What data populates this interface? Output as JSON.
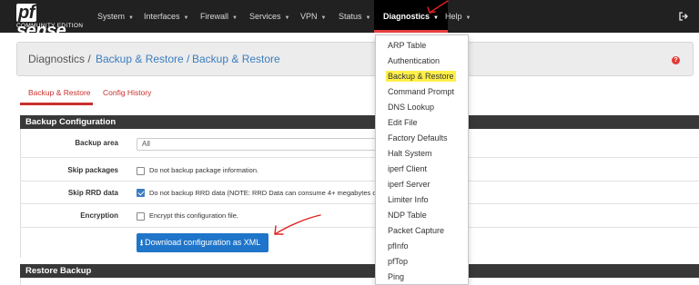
{
  "navbar": {
    "brand_logo": "sense",
    "brand_logo_prefix": "pf",
    "brand_sub": "COMMUNITY EDITION",
    "items": [
      {
        "label": "System"
      },
      {
        "label": "Interfaces"
      },
      {
        "label": "Firewall"
      },
      {
        "label": "Services"
      },
      {
        "label": "VPN"
      },
      {
        "label": "Status"
      },
      {
        "label": "Diagnostics"
      },
      {
        "label": "Help"
      }
    ],
    "active_color": "#e93f3f",
    "logout_icon": "logout-icon"
  },
  "breadcrumb": {
    "items": [
      "Diagnostics /",
      "Backup & Restore /",
      "Backup & Restore"
    ],
    "help_icon": "question-icon"
  },
  "tabs": [
    {
      "label": "Backup & Restore",
      "active": true
    },
    {
      "label": "Config History",
      "active": false
    }
  ],
  "backup_panel": {
    "title": "Backup Configuration",
    "backup_area": {
      "label": "Backup area",
      "value": "All"
    },
    "skip_packages": {
      "label": "Skip packages",
      "text": "Do not backup package information.",
      "checked": false
    },
    "skip_rrd": {
      "label": "Skip RRD data",
      "text": "Do not backup RRD data (NOTE: RRD Data can consume 4+ megabytes o",
      "checked": true
    },
    "encryption": {
      "label": "Encryption",
      "text": "Encrypt this configuration file.",
      "checked": false
    },
    "download_button": "Download configuration as XML",
    "download_icon": "download-icon"
  },
  "restore_panel": {
    "title": "Restore Backup"
  },
  "dropdown": {
    "items": [
      {
        "label": "ARP Table"
      },
      {
        "label": "Authentication"
      },
      {
        "label": "Backup & Restore",
        "highlighted": true
      },
      {
        "label": "Command Prompt"
      },
      {
        "label": "DNS Lookup"
      },
      {
        "label": "Edit File"
      },
      {
        "label": "Factory Defaults"
      },
      {
        "label": "Halt System"
      },
      {
        "label": "iperf Client"
      },
      {
        "label": "iperf Server"
      },
      {
        "label": "Limiter Info"
      },
      {
        "label": "NDP Table"
      },
      {
        "label": "Packet Capture"
      },
      {
        "label": "pfInfo"
      },
      {
        "label": "pfTop"
      },
      {
        "label": "Ping"
      }
    ],
    "highlight_color": "#fff04a"
  },
  "annotation_color": "#e02020"
}
